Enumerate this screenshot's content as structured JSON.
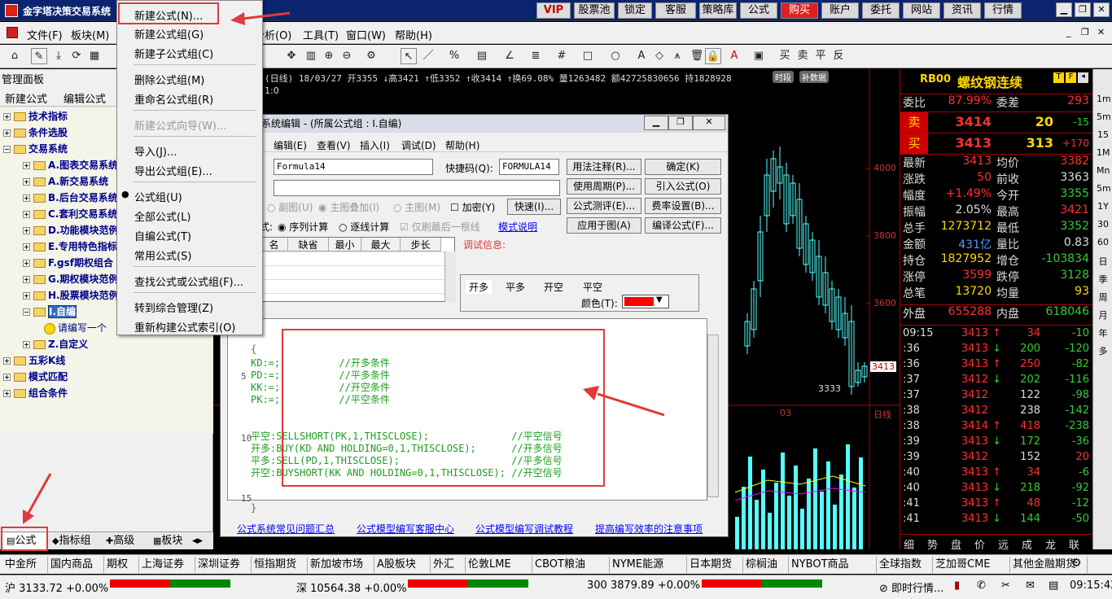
{
  "app": {
    "title": "金字塔决策交易系统"
  },
  "topbar": {
    "vip": "VIP",
    "buttons": [
      "股票池",
      "锁定",
      "客服",
      "策略库",
      "公式",
      "购买",
      "账户",
      "委托",
      "网站",
      "资讯",
      "行情"
    ]
  },
  "menubar": {
    "items": [
      "文件(F)",
      "板块(M)",
      "分析(O)",
      "工具(T)",
      "窗口(W)",
      "帮助(H)"
    ]
  },
  "left_panel": {
    "title": "管理面板",
    "tabs": [
      "新建公式",
      "编辑公式"
    ],
    "tree": [
      {
        "label": "技术指标",
        "level": 0
      },
      {
        "label": "条件选股",
        "level": 0
      },
      {
        "label": "交易系统",
        "level": 0
      },
      {
        "label": "A.图表交易系统",
        "level": 1
      },
      {
        "label": "A.新交易系统",
        "level": 1
      },
      {
        "label": "B.后台交易系统",
        "level": 1
      },
      {
        "label": "C.套利交易系统",
        "level": 1
      },
      {
        "label": "D.功能模块范例",
        "level": 1
      },
      {
        "label": "E.专用特色指标",
        "level": 1
      },
      {
        "label": "F.gsf期权组合",
        "level": 1
      },
      {
        "label": "G.期权模块范例",
        "level": 1
      },
      {
        "label": "H.股票模块范例",
        "level": 1
      },
      {
        "label": "I.自编",
        "level": 1
      },
      {
        "label": "请编写一个",
        "level": 2
      },
      {
        "label": "Z.自定义",
        "level": 1
      },
      {
        "label": "五彩K线",
        "level": 0
      },
      {
        "label": "模式匹配",
        "level": 0
      },
      {
        "label": "组合条件",
        "level": 0
      }
    ],
    "bottom_tabs": [
      "公式",
      "指标组",
      "高级",
      "板块"
    ]
  },
  "popup_menu": {
    "items": [
      "新建公式(N)...",
      "新建公式组(G)",
      "新建子公式组(C)",
      "删除公式组(M)",
      "重命名公式组(R)",
      "新建公式向导(W)...",
      "导入(J)...",
      "导出公式组(E)...",
      "公式组(U)",
      "全部公式(L)",
      "自编公式(T)",
      "常用公式(S)",
      "查找公式或公式组(F)...",
      "转到综合管理(Z)",
      "重新构建公式索引(O)"
    ]
  },
  "chart": {
    "header": "(日线) 18/03/27 开3355 ↓高3421 ↑低3352 ↑收3414 ↑换69.08% 量1263482 额42725830656 持1828928",
    "sub": "1:0",
    "tags": [
      "时段",
      "补数据"
    ],
    "price_labels": [
      "4000",
      "3800",
      "3600",
      "3413",
      "3333"
    ],
    "date_label": "03",
    "type_label": "日线"
  },
  "dialog": {
    "title": "系统编辑 - (所属公式组 : I.自编)",
    "menu": [
      "编辑(E)",
      "查看(V)",
      "插入(I)",
      "调试(D)",
      "帮助(H)"
    ],
    "name_value": "Formula14",
    "shortcut_label": "快捷码(Q):",
    "shortcut_value": "FORMULA14",
    "buttons": [
      "用法注释(R)...",
      "确定(K)",
      "使用周期(P)...",
      "引入公式(O)",
      "公式测评(E)...",
      "费率设置(B)...",
      "应用于图(A)",
      "编译公式(F)..."
    ],
    "options": [
      "副图(U)",
      "主图叠加(I)",
      "主图(M)",
      "加密(Y)"
    ],
    "speed_btn": "快速(I)...",
    "calc_label": "式:",
    "calc_opts": [
      "序列计算",
      "逐线计算",
      "仅刷最后一根线"
    ],
    "mode_link": "模式说明",
    "param_cols": [
      "名",
      "缺省",
      "最小",
      "最大",
      "步长"
    ],
    "debug_label": "调试信息:",
    "signal_tabs": [
      "开多",
      "平多",
      "开空",
      "平空"
    ],
    "color_label": "颜色(T):",
    "code_lines": [
      "{",
      "KD:=;          //开多条件",
      "PD:=;          //平多条件",
      "KK:=;          //开空条件",
      "PK:=;          //平空条件",
      "",
      "",
      "平空:SELLSHORT(PK,1,THISCLOSE);              //平空信号",
      "开多:BUY(KD AND HOLDING=0,1,THISCLOSE);      //开多信号",
      "平多:SELL(PD,1,THISCLOSE);                   //平多信号",
      "开空:BUYSHORT(KK AND HOLDING=0,1,THISCLOSE); //开空信号",
      "",
      "",
      "}"
    ],
    "line_numbers": [
      "5",
      "10",
      "15"
    ],
    "links": [
      "公式系统常见问题汇总",
      "公式模型编写客服中心",
      "公式模型编写调试教程",
      "提高编写效率的注意事项"
    ]
  },
  "quote": {
    "code": "RB00",
    "name": "螺纹钢连续",
    "wb": {
      "label": "委比",
      "value": "87.99%",
      "label2": "委差",
      "value2": "293"
    },
    "sell": {
      "label": "卖",
      "price": "3414",
      "vol": "20",
      "chg": "-15"
    },
    "buy": {
      "label": "买",
      "price": "3413",
      "vol": "313",
      "chg": "+170"
    },
    "rows": [
      [
        "最新",
        "3413",
        "均价",
        "3382"
      ],
      [
        "涨跌",
        "50",
        "前收",
        "3363"
      ],
      [
        "幅度",
        "+1.49%",
        "今开",
        "3355"
      ],
      [
        "振幅",
        "2.05%",
        "最高",
        "3421"
      ],
      [
        "总手",
        "1273712",
        "最低",
        "3352"
      ],
      [
        "金额",
        "431亿",
        "量比",
        "0.83"
      ],
      [
        "持仓",
        "1827952",
        "增仓",
        "-103834"
      ],
      [
        "涨停",
        "3599",
        "跌停",
        "3128"
      ],
      [
        "总笔",
        "13720",
        "均量",
        "93"
      ],
      [
        "外盘",
        "655288",
        "内盘",
        "618046"
      ]
    ],
    "ticks": [
      [
        "09:15",
        "3413",
        "↑",
        "34",
        "-10"
      ],
      [
        ":36",
        "3413",
        "↓",
        "200",
        "-120"
      ],
      [
        ":36",
        "3413",
        "↑",
        "250",
        "-82"
      ],
      [
        ":37",
        "3412",
        "↓",
        "202",
        "-116"
      ],
      [
        ":37",
        "3412",
        "",
        "122",
        "-98"
      ],
      [
        ":38",
        "3412",
        "",
        "238",
        "-142"
      ],
      [
        ":38",
        "3414",
        "↑",
        "418",
        "-238"
      ],
      [
        ":39",
        "3413",
        "↓",
        "172",
        "-36"
      ],
      [
        ":39",
        "3412",
        "",
        "152",
        "20"
      ],
      [
        ":40",
        "3413",
        "↑",
        "34",
        "-6"
      ],
      [
        ":40",
        "3413",
        "↓",
        "218",
        "-92"
      ],
      [
        ":41",
        "3413",
        "↑",
        "48",
        "-12"
      ],
      [
        ":41",
        "3413",
        "↓",
        "144",
        "-50"
      ]
    ],
    "bottom_tabs": [
      "细",
      "势",
      "盘",
      "价",
      "远",
      "成",
      "龙",
      "联"
    ]
  },
  "rightbar": [
    "1m",
    "5m",
    "15",
    "1M",
    "Mn",
    "5m",
    "1Y",
    "30",
    "60",
    "日",
    "季",
    "周",
    "月",
    "年",
    "多"
  ],
  "market_tabs": [
    "中金所",
    "国内商品",
    "期权",
    "上海证券",
    "深圳证券",
    "恒指期货",
    "新加坡市场",
    "A股板块",
    "外汇",
    "伦敦LME",
    "CBOT粮油",
    "NYME能源",
    "日本期货",
    "棕榈油",
    "NYBOT商品",
    "全球指数",
    "芝加哥CME",
    "其他金融期货"
  ],
  "status": {
    "sh": "沪 3133.72 +0.00%",
    "sz": "深 10564.38 +0.00%",
    "hs": "300 3879.89 +0.00%",
    "live": "即时行情...",
    "time": "09:15:42"
  }
}
